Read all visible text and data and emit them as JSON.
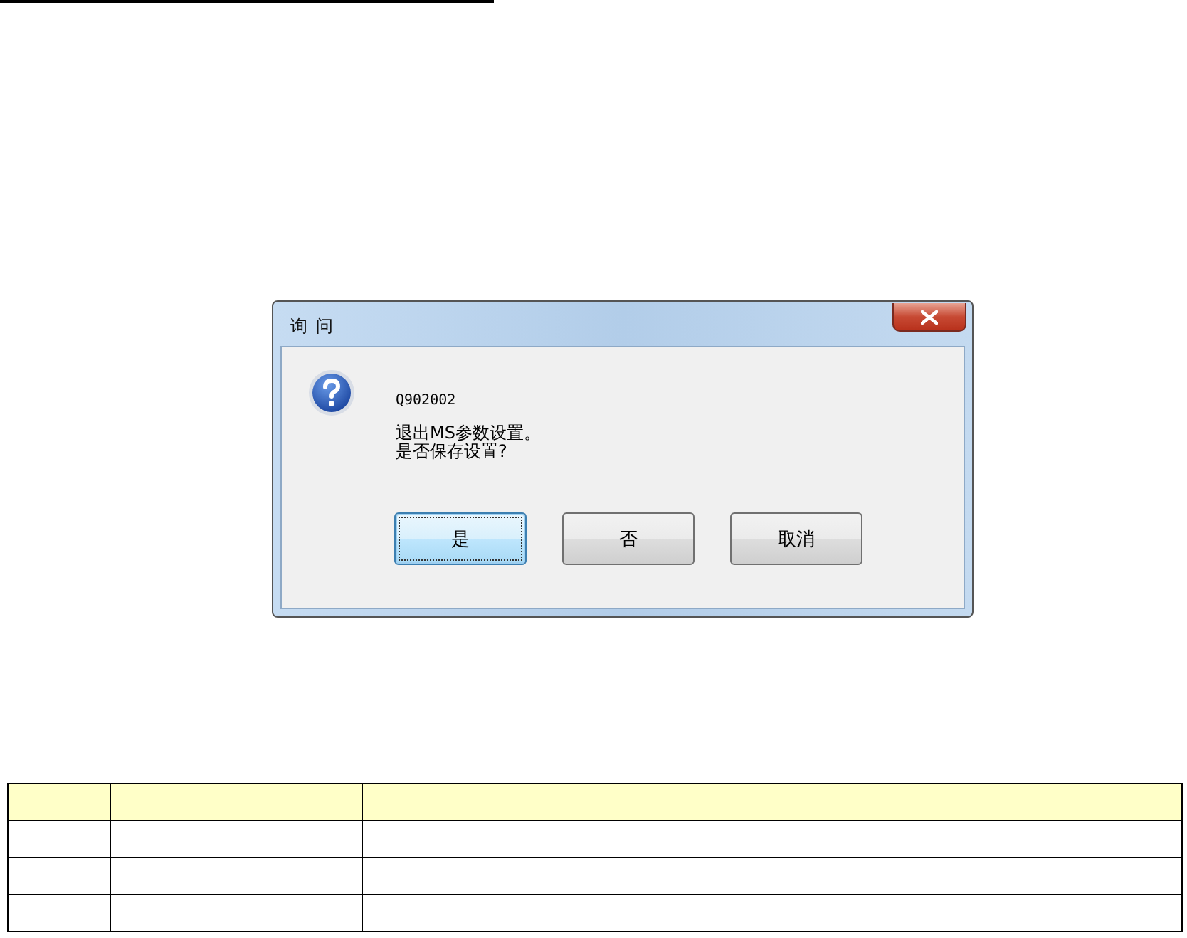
{
  "dialog": {
    "title": "询 问",
    "code": "Q902002",
    "message_lines": [
      "退出MS参数设置。",
      "是否保存设置?"
    ],
    "buttons": [
      {
        "label": "是",
        "default": true
      },
      {
        "label": "否",
        "default": false
      },
      {
        "label": "取消",
        "default": false
      }
    ]
  }
}
